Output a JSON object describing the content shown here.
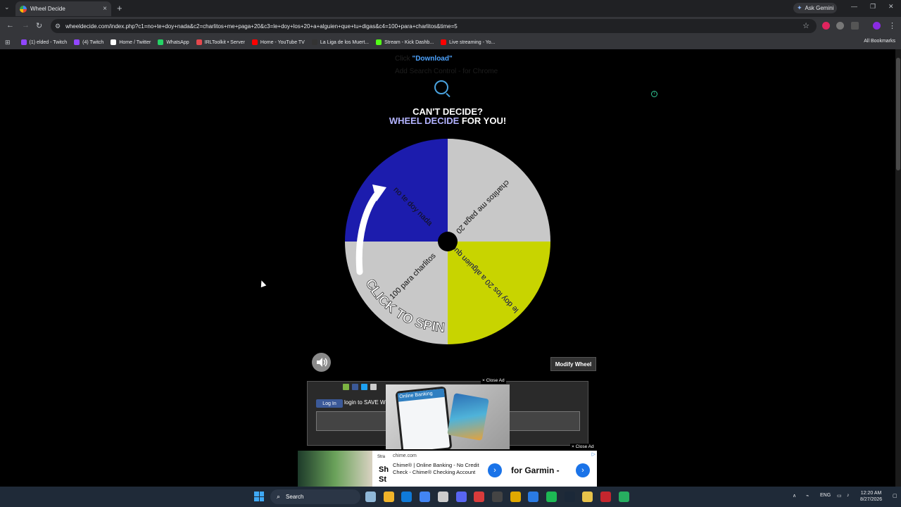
{
  "browser": {
    "tab_title": "Wheel Decide",
    "tab_close": "×",
    "new_tab": "+",
    "tab_menu": "⌄",
    "gemini_label": "Ask Gemini",
    "url": "wheeldecide.com/index.php?c1=no+te+doy+nada&c2=charlitos+me+paga+20&c3=le+doy+los+20+a+alguien+que+tu+digas&c4=100+para+charlitos&time=5",
    "bookmarks": [
      {
        "label": "(1) elded - Twitch",
        "color": "#9146ff"
      },
      {
        "label": "(4) Twitch",
        "color": "#9146ff"
      },
      {
        "label": "Home / Twitter",
        "color": "#ffffff"
      },
      {
        "label": "WhatsApp",
        "color": "#25d366"
      },
      {
        "label": "IRLToolkit • Server",
        "color": "#e5484d"
      },
      {
        "label": "Home - YouTube TV",
        "color": "#ff0000"
      },
      {
        "label": "La Liga de los Muert...",
        "color": "#333333"
      },
      {
        "label": "Stream - Kick Dashb...",
        "color": "#53fc18"
      },
      {
        "label": "Live streaming - Yo...",
        "color": "#ff0000"
      }
    ],
    "all_bookmarks": "All Bookmarks"
  },
  "page": {
    "ghost_click": "Click ",
    "ghost_download": "\"Download\"",
    "ghost_add": "Add Search Control - for Chrome",
    "headline_line1": "CAN'T DECIDE?",
    "headline_blue": "WHEEL DECIDE",
    "headline_rest": " FOR YOU!",
    "wheel": {
      "spin_label": "CLICK TO SPIN",
      "segments": [
        {
          "label": "100 para charlitos",
          "color": "#c8c8c8"
        },
        {
          "label": "no te doy nada",
          "color": "#c8d400"
        },
        {
          "label": "charlitos me paga 20",
          "color": "#c8c8c8"
        },
        {
          "label": "le doy los 20 a alguien que...",
          "color": "#1c1cad"
        }
      ]
    },
    "modify_label": "Modify Wheel",
    "fb_login": "Log In",
    "login_text": "login to SAVE W",
    "close_ad_1": "× Close Ad",
    "close_ad_2": "× Close Ad",
    "ad_phone_title": "Online Banking",
    "ad2": {
      "side_small": "Stra",
      "side_big_1": "Sh",
      "side_big_2": "St",
      "domain": "chime.com",
      "title": "Chime® | Online Banking - No Credit Check - Chime® Checking Account",
      "garmin": "for Garmin -",
      "arrow": "›"
    }
  },
  "taskbar": {
    "search_label": "Search",
    "lang": "ENG",
    "time": "12:20 AM",
    "date": "8/27/2026",
    "apps": [
      "#8fb8d8",
      "#f0b429",
      "#0f7ad8",
      "#4285f4",
      "#cccccc",
      "#5865f2",
      "#d83b3b",
      "#444444",
      "#e0a800",
      "#2a7be4",
      "#1db954",
      "#1b2838",
      "#e8c34a",
      "#c4262e",
      "#27ae60"
    ]
  }
}
